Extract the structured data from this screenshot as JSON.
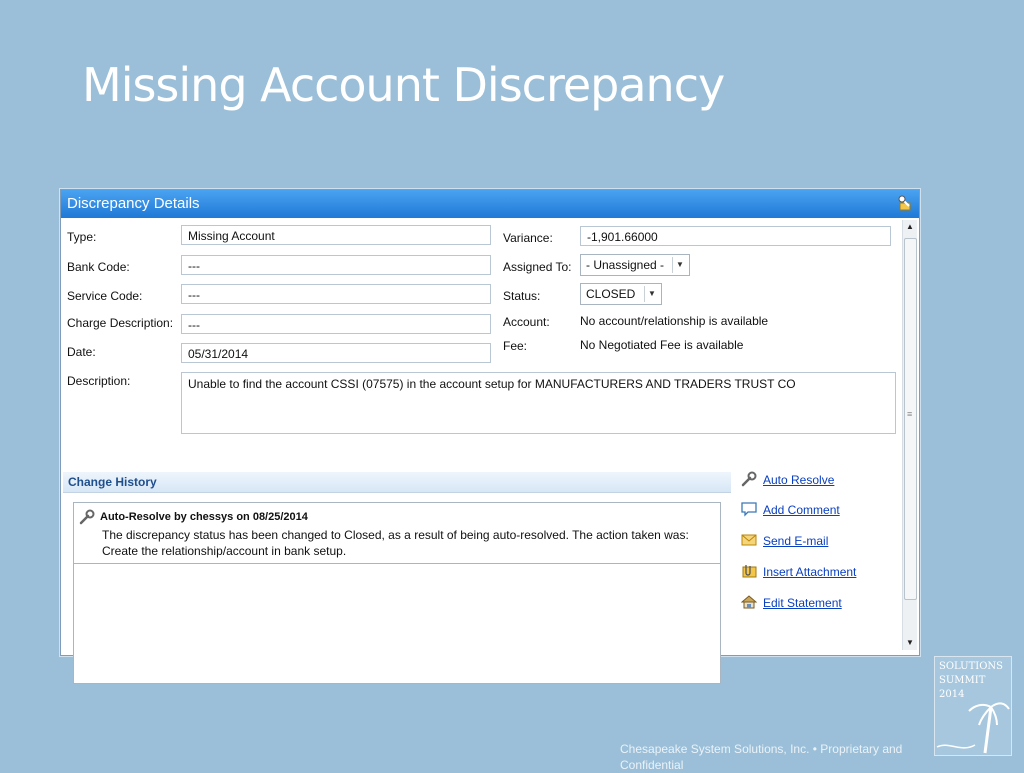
{
  "slide": {
    "title": "Missing Account Discrepancy",
    "footer": "Chesapeake System Solutions, Inc. •  Proprietary and Confidential",
    "logo": {
      "line1": "SOLUTIONS",
      "line2": "SUMMIT",
      "line3": "2014"
    }
  },
  "window": {
    "title": "Discrepancy Details"
  },
  "form": {
    "type": {
      "label": "Type:",
      "value": "Missing Account"
    },
    "bank_code": {
      "label": "Bank Code:",
      "value": "---"
    },
    "service_code": {
      "label": "Service Code:",
      "value": "---"
    },
    "charge_description": {
      "label": "Charge Description:",
      "value": "---"
    },
    "date": {
      "label": "Date:",
      "value": "05/31/2014"
    },
    "description": {
      "label": "Description:",
      "value": "Unable to find the account CSSI (07575) in the account setup for MANUFACTURERS AND TRADERS TRUST CO"
    },
    "variance": {
      "label": "Variance:",
      "value": "-1,901.66000"
    },
    "assigned_to": {
      "label": "Assigned To:",
      "value": "- Unassigned -"
    },
    "status": {
      "label": "Status:",
      "value": "CLOSED"
    },
    "account": {
      "label": "Account:",
      "value": "No account/relationship is available"
    },
    "fee": {
      "label": "Fee:",
      "value": "No Negotiated Fee is available"
    }
  },
  "change_history": {
    "title": "Change History",
    "entries": [
      {
        "title": "Auto-Resolve by chessys on 08/25/2014",
        "line1": "The discrepancy status has been changed to Closed, as a result of being auto-resolved.  The action taken was:",
        "line2": "Create the relationship/account in bank setup."
      }
    ]
  },
  "actions": [
    {
      "label": "Auto Resolve",
      "icon": "wrench-icon"
    },
    {
      "label": "Add Comment",
      "icon": "comment-icon"
    },
    {
      "label": "Send E-mail",
      "icon": "envelope-icon"
    },
    {
      "label": "Insert Attachment",
      "icon": "attachment-icon"
    },
    {
      "label": "Edit Statement",
      "icon": "edit-statement-icon"
    }
  ],
  "colors": {
    "background": "#9bbfd8",
    "header": "#2f8ae2",
    "link": "#0a3fbf"
  }
}
